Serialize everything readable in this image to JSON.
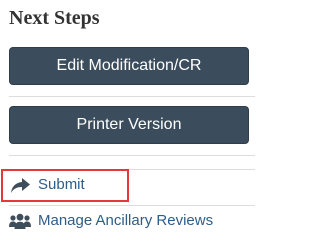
{
  "panel": {
    "title": "Next Steps"
  },
  "buttons": {
    "edit_label": "Edit Modification/CR",
    "print_label": "Printer Version"
  },
  "links": [
    {
      "label": "Submit",
      "icon": "share-arrow-icon",
      "highlighted": true
    },
    {
      "label": "Manage Ancillary Reviews",
      "icon": "users-icon",
      "highlighted": false
    }
  ],
  "colors": {
    "button_bg": "#3b4d5c",
    "link_text": "#2e5d8a",
    "icon": "#3f4e5b",
    "highlight_border": "#e53935"
  }
}
